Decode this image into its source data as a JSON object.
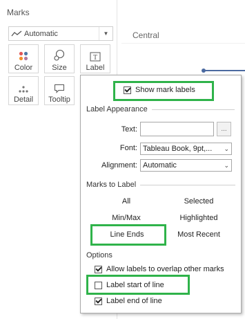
{
  "marks": {
    "title": "Marks",
    "mark_type": "Automatic",
    "buttons": [
      {
        "label": "Color"
      },
      {
        "label": "Size"
      },
      {
        "label": "Label"
      },
      {
        "label": "Detail"
      },
      {
        "label": "Tooltip"
      }
    ]
  },
  "view": {
    "column_header": "Central"
  },
  "popup": {
    "show_mark_labels": {
      "label": "Show mark labels",
      "checked": true
    },
    "label_appearance": {
      "title": "Label Appearance",
      "text_label": "Text:",
      "text_value": "",
      "ellipsis": "...",
      "font_label": "Font:",
      "font_value": "Tableau Book, 9pt,...",
      "alignment_label": "Alignment:",
      "alignment_value": "Automatic"
    },
    "marks_to_label": {
      "title": "Marks to Label",
      "options": [
        "All",
        "Selected",
        "Min/Max",
        "Highlighted",
        "Line Ends",
        "Most Recent"
      ],
      "selected": "Line Ends"
    },
    "options": {
      "title": "Options",
      "allow_overlap": {
        "label": "Allow labels to overlap other marks",
        "checked": true
      },
      "label_start": {
        "label": "Label start of line",
        "checked": false
      },
      "label_end": {
        "label": "Label end of line",
        "checked": true
      }
    }
  },
  "colors": {
    "highlight": "#2fb34a",
    "line": "#4b6aa0"
  }
}
